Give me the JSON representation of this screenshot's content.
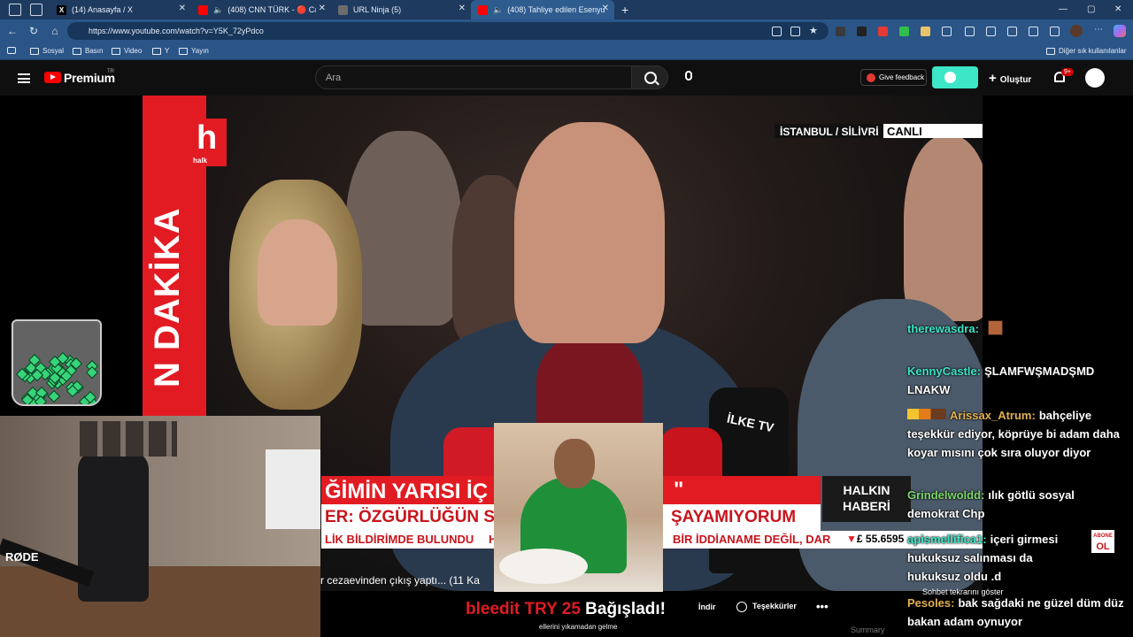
{
  "browser": {
    "tabs": [
      {
        "label": "(14) Anasayfa / X",
        "fav": "X",
        "color": "#000000"
      },
      {
        "label": "(408) CNN TÜRK - 🔴 Canlı Y",
        "fav": "",
        "color": "#ff0000"
      },
      {
        "label": "URL Ninja (5)",
        "fav": "",
        "color": "#555555"
      },
      {
        "label": "(408) Tahliye edilen Esenyurt",
        "fav": "",
        "color": "#ff0000"
      }
    ],
    "new_tab": "+",
    "url": "https://www.youtube.com/watch?v=Y5K_72yPdco",
    "bookmarks": [
      "Sosyal",
      "Basın",
      "Video",
      "Y",
      "Yayın"
    ],
    "other_bookmarks": "Diğer sık kullanılanlar",
    "win_min": "—",
    "win_max": "▢",
    "win_close": "✕"
  },
  "youtube": {
    "brand": "Premium",
    "region": "TR",
    "search_placeholder": "Ara",
    "feedback": "Give feedback",
    "create": "Oluştur",
    "notifications": "9+"
  },
  "video": {
    "channel_logo": "h",
    "channel_word": "halk",
    "breaking": "N DAKİKA",
    "location": "İSTANBUL / SİLİVRİ",
    "live": "CANLI",
    "headline_top": "ĞİMİN YARISI İÇ",
    "headline_quote": "\"",
    "headline_bottom": "ER: ÖZGÜRLÜĞÜN SEVİN",
    "headline_bottom_end": "ŞAYAMIYORUM",
    "ticker_left": "LİK BİLDİRİMDE BULUNDU",
    "ticker_mid": "H",
    "ticker_right": "BİR İDDİANAME DEĞİL, DAR",
    "program_line1": "HALKIN",
    "program_line2": "HABERİ",
    "gbp": "£ 55.6595",
    "mic_label": "İLKE TV",
    "camera_brand": "RØDE"
  },
  "below_video": {
    "title_fragment": "r cezaevinden çıkış yaptı... (11 Ka",
    "donation_user": "bleedit",
    "donation_amount": "TRY 25",
    "donation_word": "Bağışladı!",
    "donation_message": "ellerini yıkamadan gelme",
    "download": "İndir",
    "thanks": "Teşekkürler",
    "more": "•••",
    "summary": "Summary"
  },
  "chat": {
    "messages": [
      {
        "user": "therewasdra:",
        "color": "#3ee6c8",
        "text": ""
      },
      {
        "user": "KennyCastle:",
        "color": "#3ee6c8",
        "text": "ŞLAMFWŞMADŞMD LNAKW"
      },
      {
        "user": "Arissax_Atrum:",
        "color": "#e3b04b",
        "text": "bahçeliye teşekkür ediyor, köprüye bi adam daha koyar mısını çok sıra oluyor diyor"
      },
      {
        "user": "Grindelwoldd:",
        "color": "#7fd86b",
        "text": "ılık götlü sosyal demokrat Chp"
      },
      {
        "user": "apismellifica1:",
        "color": "#3ee6c8",
        "text": "içeri girmesi hukuksuz salınması da hukuksuz oldu .d"
      },
      {
        "user": "Pesoles:",
        "color": "#e3b04b",
        "text": "bak sağdaki ne güzel düm düz bakan adam oynuyor"
      }
    ],
    "replay_notice": "Sohbet tekrarını göster",
    "logo_top": "ABONE",
    "logo_bottom": "OL"
  }
}
